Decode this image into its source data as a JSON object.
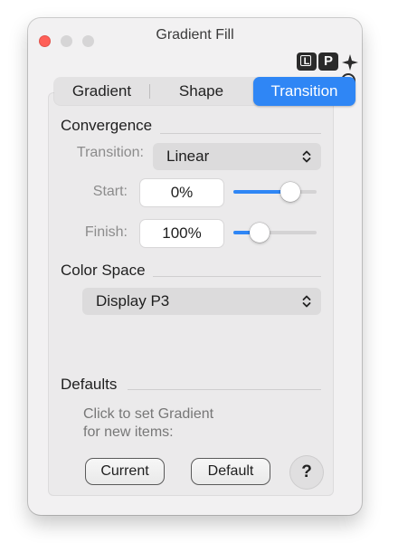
{
  "window": {
    "title": "Gradient Fill"
  },
  "toolbar": {
    "lp_left": "L",
    "lp_right": "P"
  },
  "tabs": [
    {
      "label": "Gradient",
      "selected": false
    },
    {
      "label": "Shape",
      "selected": false
    },
    {
      "label": "Transition",
      "selected": true
    }
  ],
  "convergence": {
    "heading": "Convergence",
    "transition": {
      "label": "Transition:",
      "value": "Linear"
    },
    "start": {
      "label": "Start:",
      "value": "0%",
      "slider_fraction": 0.68
    },
    "finish": {
      "label": "Finish:",
      "value": "100%",
      "slider_fraction": 0.32
    }
  },
  "color_space": {
    "heading": "Color Space",
    "value": "Display P3"
  },
  "defaults": {
    "heading": "Defaults",
    "hint_line1": "Click to set Gradient",
    "hint_line2": "for new items:",
    "current_label": "Current",
    "default_label": "Default",
    "help_label": "?"
  },
  "colors": {
    "accent": "#2f86f5",
    "close": "#ff5f57",
    "panel": "#f2f1f2"
  }
}
